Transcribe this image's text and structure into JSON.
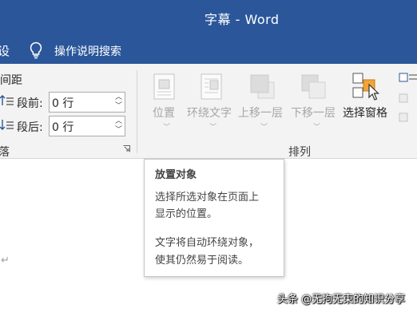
{
  "window": {
    "title": "字幕 - Word"
  },
  "tell_me": {
    "tab_partial": "设",
    "label": "操作说明搜索"
  },
  "paragraph_group": {
    "spacing_header": "间距",
    "before_label": "段前:",
    "before_value": "0 行",
    "after_label": "段后:",
    "after_value": "0 行",
    "group_label_partial": "落"
  },
  "arrange_group": {
    "label": "排列",
    "buttons": [
      {
        "label": "位置",
        "icon": "position-icon",
        "enabled": false
      },
      {
        "label": "环绕文字",
        "icon": "wrap-text-icon",
        "enabled": false
      },
      {
        "label": "上移一层",
        "icon": "bring-forward-icon",
        "enabled": false
      },
      {
        "label": "下移一层",
        "icon": "send-backward-icon",
        "enabled": false
      },
      {
        "label": "选择窗格",
        "icon": "selection-pane-icon",
        "enabled": true
      }
    ]
  },
  "tooltip": {
    "title": "放置对象",
    "line1": "选择所选对象在页面上",
    "line2": "显示的位置。",
    "line3": "文字将自动环绕对象，",
    "line4": "使其仍然易于阅读。"
  },
  "document": {
    "paragraph_mark": "↵"
  },
  "watermark": "头条 @无拘无束的知识分享",
  "colors": {
    "title_bar": "#2b579a",
    "ribbon": "#f3f3f3",
    "disabled_text": "#a6a6a6"
  }
}
